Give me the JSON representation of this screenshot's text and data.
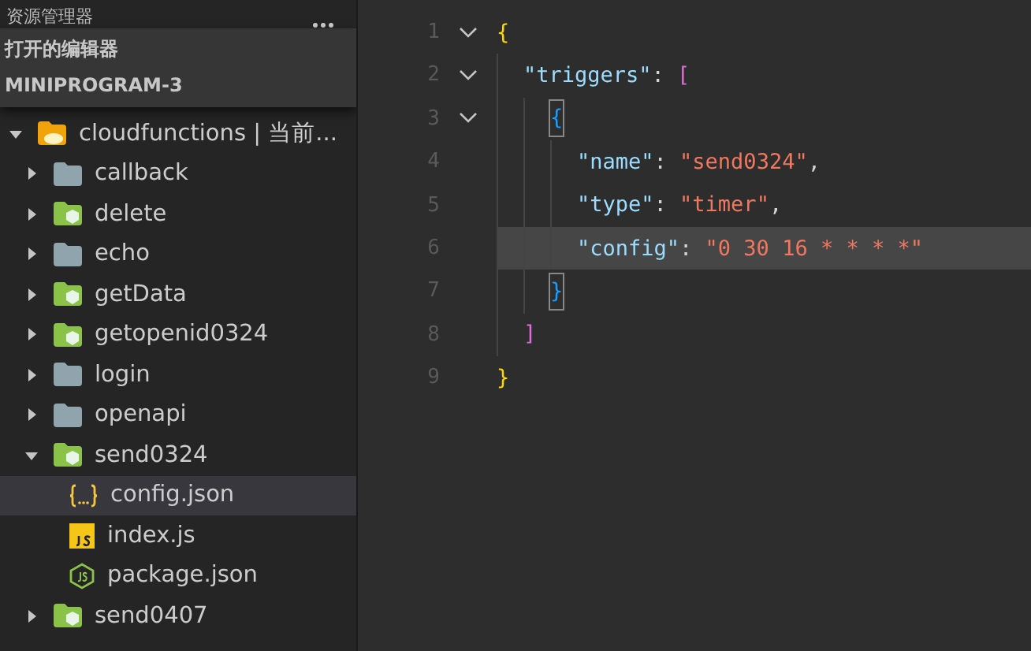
{
  "sidebar": {
    "title": "资源管理器",
    "sections": [
      {
        "label": "打开的编辑器"
      },
      {
        "label": "MINIPROGRAM-3"
      }
    ],
    "tree": [
      {
        "label": "cloudfunctions | 当前...",
        "kind": "cloud-root",
        "expanded": true,
        "selected": false,
        "children": [
          {
            "label": "callback",
            "kind": "folder",
            "expanded": false,
            "selected": false
          },
          {
            "label": "delete",
            "kind": "cloud-folder",
            "expanded": false,
            "selected": false
          },
          {
            "label": "echo",
            "kind": "folder",
            "expanded": false,
            "selected": false
          },
          {
            "label": "getData",
            "kind": "cloud-folder",
            "expanded": false,
            "selected": false
          },
          {
            "label": "getopenid0324",
            "kind": "cloud-folder",
            "expanded": false,
            "selected": false
          },
          {
            "label": "login",
            "kind": "folder",
            "expanded": false,
            "selected": false
          },
          {
            "label": "openapi",
            "kind": "folder",
            "expanded": false,
            "selected": false
          },
          {
            "label": "send0324",
            "kind": "cloud-folder",
            "expanded": true,
            "selected": false,
            "children": [
              {
                "label": "config.json",
                "kind": "json",
                "selected": true
              },
              {
                "label": "index.js",
                "kind": "js",
                "selected": false
              },
              {
                "label": "package.json",
                "kind": "node",
                "selected": false
              }
            ]
          },
          {
            "label": "send0407",
            "kind": "cloud-folder",
            "expanded": false,
            "selected": false
          }
        ]
      }
    ]
  },
  "editor": {
    "lines": [
      {
        "number": "1",
        "foldable": true,
        "selected": false,
        "tokens": [
          {
            "text": "{",
            "kind": "bracket",
            "color": "#ffd700",
            "matched": false
          }
        ],
        "children": [
          {
            "number": "2",
            "foldable": true,
            "selected": false,
            "tokens": [
              {
                "text": "\"triggers\"",
                "kind": "key",
                "matched": false
              },
              {
                "text": ": ",
                "kind": "punct",
                "matched": false
              },
              {
                "text": "[",
                "kind": "bracket",
                "color": "#da70d6",
                "matched": false
              }
            ],
            "children": [
              {
                "number": "3",
                "foldable": true,
                "selected": false,
                "tokens": [
                  {
                    "text": "{",
                    "kind": "bracket",
                    "color": "#179fff",
                    "matched": true
                  }
                ],
                "children": [
                  {
                    "number": "4",
                    "foldable": false,
                    "selected": false,
                    "tokens": [
                      {
                        "text": "\"name\"",
                        "kind": "key",
                        "matched": false
                      },
                      {
                        "text": ": ",
                        "kind": "punct",
                        "matched": false
                      },
                      {
                        "text": "\"send0324\"",
                        "kind": "string",
                        "matched": false
                      },
                      {
                        "text": ",",
                        "kind": "punct",
                        "matched": false
                      }
                    ]
                  },
                  {
                    "number": "5",
                    "foldable": false,
                    "selected": false,
                    "tokens": [
                      {
                        "text": "\"type\"",
                        "kind": "key",
                        "matched": false
                      },
                      {
                        "text": ": ",
                        "kind": "punct",
                        "matched": false
                      },
                      {
                        "text": "\"timer\"",
                        "kind": "string",
                        "matched": false
                      },
                      {
                        "text": ",",
                        "kind": "punct",
                        "matched": false
                      }
                    ]
                  },
                  {
                    "number": "6",
                    "foldable": false,
                    "selected": true,
                    "tokens": [
                      {
                        "text": "\"config\"",
                        "kind": "key",
                        "matched": false
                      },
                      {
                        "text": ": ",
                        "kind": "punct",
                        "matched": false
                      },
                      {
                        "text": "\"0 30 16 * * * *\"",
                        "kind": "string",
                        "matched": false
                      }
                    ]
                  }
                ]
              },
              {
                "number": "7",
                "foldable": false,
                "selected": false,
                "tokens": [
                  {
                    "text": "}",
                    "kind": "bracket",
                    "color": "#179fff",
                    "matched": true
                  }
                ]
              }
            ]
          },
          {
            "number": "8",
            "foldable": false,
            "selected": false,
            "tokens": [
              {
                "text": "]",
                "kind": "bracket",
                "color": "#da70d6",
                "matched": false
              }
            ]
          }
        ]
      },
      {
        "number": "9",
        "foldable": false,
        "selected": false,
        "tokens": [
          {
            "text": "}",
            "kind": "bracket",
            "color": "#ffd700",
            "matched": false
          }
        ]
      }
    ]
  }
}
